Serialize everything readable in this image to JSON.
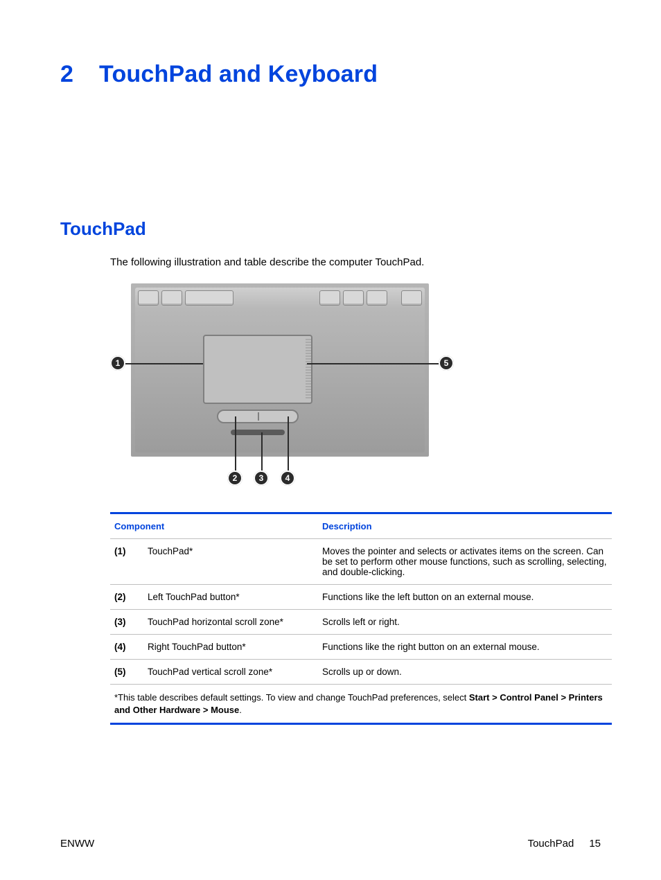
{
  "chapter": {
    "number": "2",
    "title": "TouchPad and Keyboard"
  },
  "section": {
    "title": "TouchPad"
  },
  "intro": "The following illustration and table describe the computer TouchPad.",
  "callouts": {
    "c1": "1",
    "c2": "2",
    "c3": "3",
    "c4": "4",
    "c5": "5"
  },
  "table": {
    "head": {
      "component": "Component",
      "description": "Description"
    },
    "rows": [
      {
        "num": "(1)",
        "comp": "TouchPad*",
        "desc": "Moves the pointer and selects or activates items on the screen. Can be set to perform other mouse functions, such as scrolling, selecting, and double-clicking."
      },
      {
        "num": "(2)",
        "comp": "Left TouchPad button*",
        "desc": "Functions like the left button on an external mouse."
      },
      {
        "num": "(3)",
        "comp": "TouchPad horizontal scroll zone*",
        "desc": "Scrolls left or right."
      },
      {
        "num": "(4)",
        "comp": "Right TouchPad button*",
        "desc": "Functions like the right button on an external mouse."
      },
      {
        "num": "(5)",
        "comp": "TouchPad vertical scroll zone*",
        "desc": "Scrolls up or down."
      }
    ],
    "note_pre": "*This table describes default settings. To view and change TouchPad preferences, select ",
    "note_bold": "Start > Control Panel > Printers and Other Hardware > Mouse",
    "note_post": "."
  },
  "footer": {
    "left": "ENWW",
    "section": "TouchPad",
    "page": "15"
  }
}
